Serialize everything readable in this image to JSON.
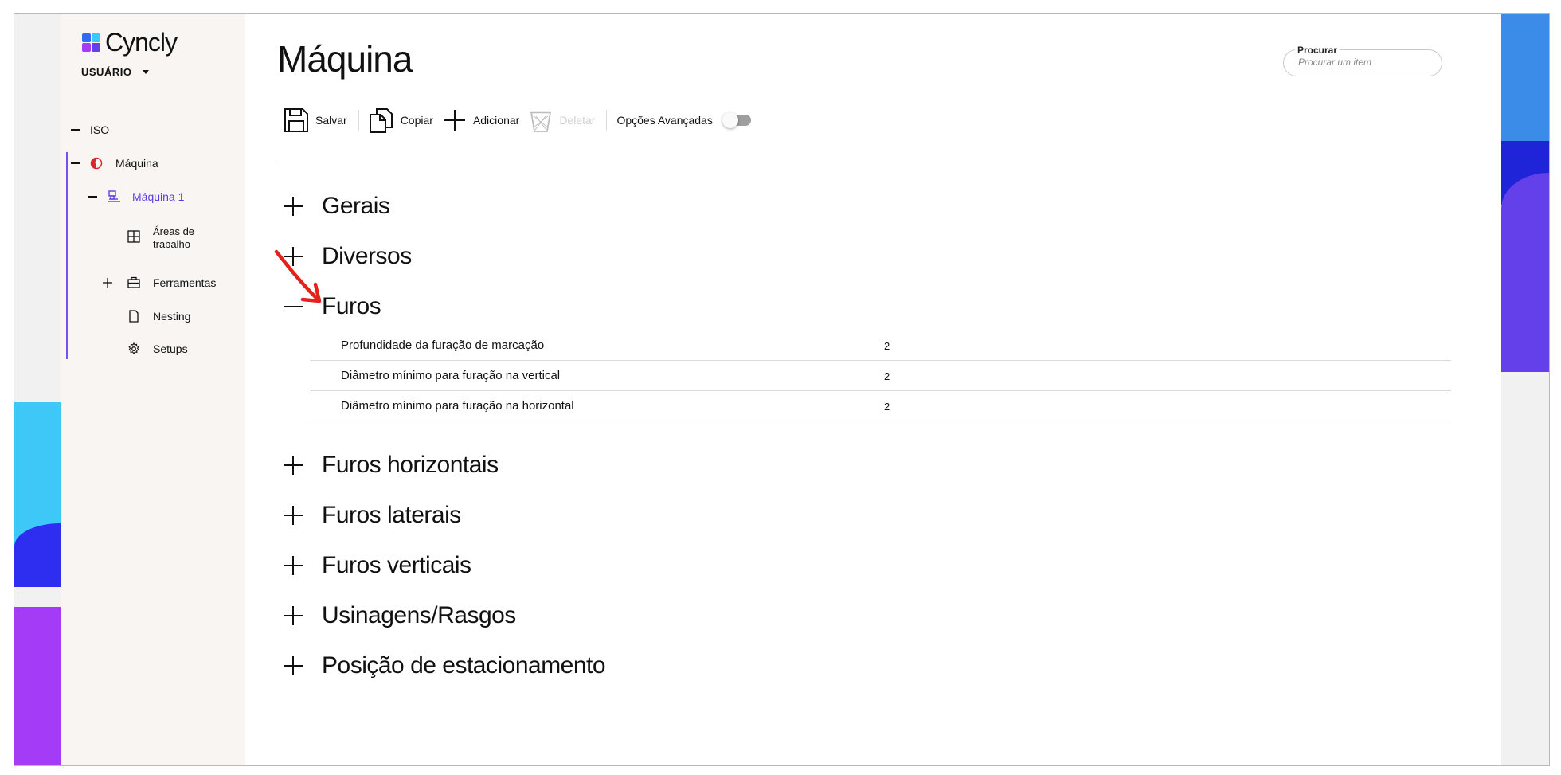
{
  "brand": {
    "name": "Cyncly"
  },
  "user": {
    "label": "USUÁRIO"
  },
  "tree": {
    "iso": "ISO",
    "maquina": "Máquina",
    "maquina1": "Máquina 1",
    "areas_line1": "Áreas de",
    "areas_line2": "trabalho",
    "ferramentas": "Ferramentas",
    "nesting": "Nesting",
    "setups": "Setups"
  },
  "page": {
    "title": "Máquina"
  },
  "search": {
    "label": "Procurar",
    "placeholder": "Procurar um item"
  },
  "toolbar": {
    "save": "Salvar",
    "copy": "Copiar",
    "add": "Adicionar",
    "delete": "Deletar",
    "advanced": "Opções Avançadas",
    "advanced_on": false
  },
  "sections": [
    {
      "label": "Gerais",
      "expanded": false
    },
    {
      "label": "Diversos",
      "expanded": false
    },
    {
      "label": "Furos",
      "expanded": true
    },
    {
      "label": "Furos horizontais",
      "expanded": false
    },
    {
      "label": "Furos laterais",
      "expanded": false
    },
    {
      "label": "Furos verticais",
      "expanded": false
    },
    {
      "label": "Usinagens/Rasgos",
      "expanded": false
    },
    {
      "label": "Posição de estacionamento",
      "expanded": false
    }
  ],
  "furos_props": [
    {
      "label": "Profundidade da furação de marcação",
      "value": "2"
    },
    {
      "label": "Diâmetro mínimo para furação na vertical",
      "value": "2"
    },
    {
      "label": "Diâmetro mínimo para furação na horizontal",
      "value": "2"
    }
  ],
  "colors": {
    "accent": "#5a3fe0",
    "sidebar_bg": "#f8f5f2",
    "annotation_arrow": "#e5211b"
  },
  "icons": {
    "save": "floppy-disk-icon",
    "copy": "copy-icon",
    "add": "plus-icon",
    "delete": "trash-icon",
    "maquina": "machine-red-icon",
    "maquina1": "machine-icon",
    "areas": "grid-icon",
    "ferramentas": "toolbox-icon",
    "nesting": "document-icon",
    "setups": "gear-icon"
  }
}
